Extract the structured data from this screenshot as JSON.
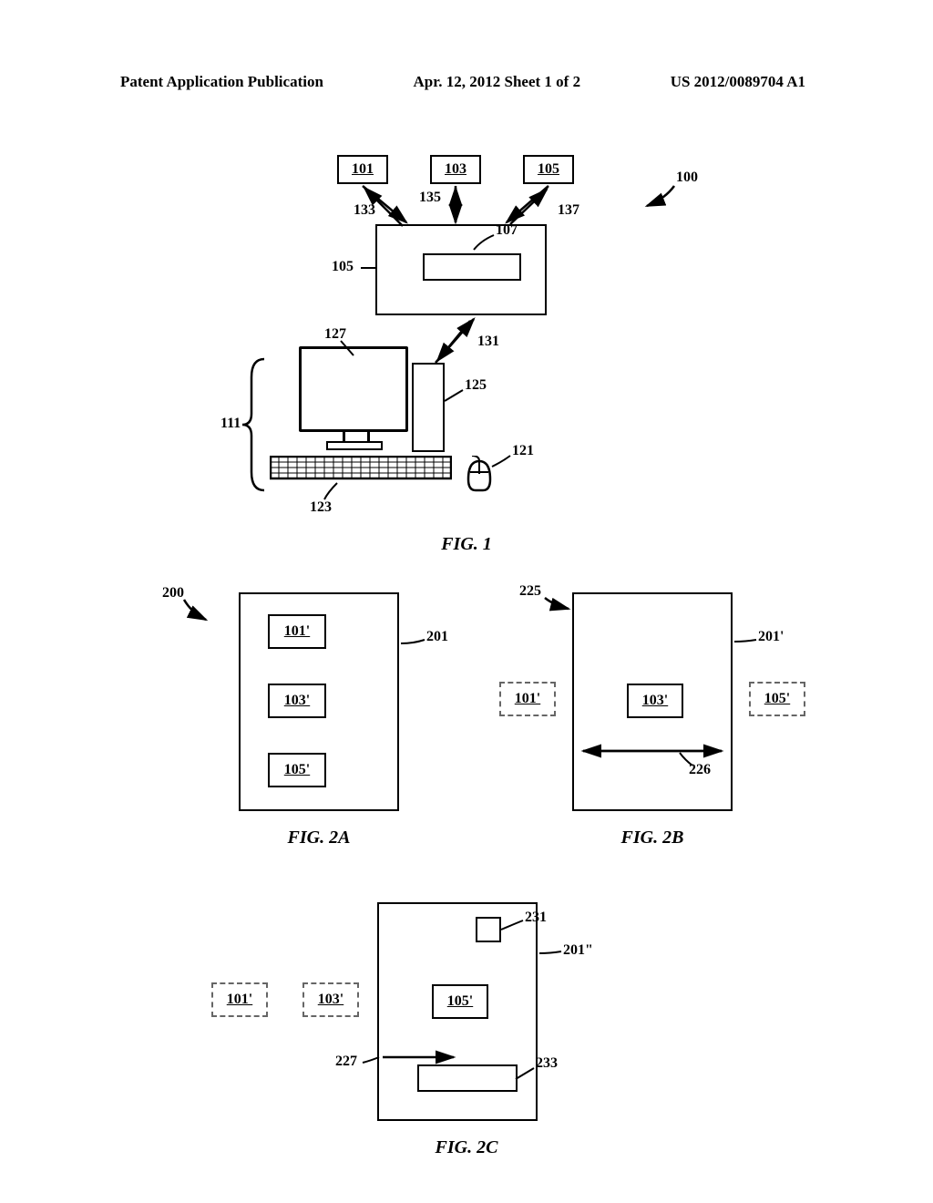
{
  "header": {
    "left": "Patent Application Publication",
    "center": "Apr. 12, 2012  Sheet 1 of 2",
    "right": "US 2012/0089704 A1"
  },
  "labels": {
    "n100": "100",
    "n101": "101",
    "n103": "103",
    "n105": "105",
    "n107": "107",
    "n111": "111",
    "n121": "121",
    "n123": "123",
    "n125": "125",
    "n127": "127",
    "n131": "131",
    "n133": "133",
    "n135": "135",
    "n137": "137",
    "n200": "200",
    "n201": "201",
    "n201p": "201'",
    "n201pp": "201\"",
    "n225": "225",
    "n226": "226",
    "n227": "227",
    "n231": "231",
    "n233": "233",
    "n101p": "101'",
    "n103p": "103'",
    "n105p": "105'"
  },
  "figs": {
    "f1": "FIG. 1",
    "f2a": "FIG. 2A",
    "f2b": "FIG. 2B",
    "f2c": "FIG. 2C"
  }
}
